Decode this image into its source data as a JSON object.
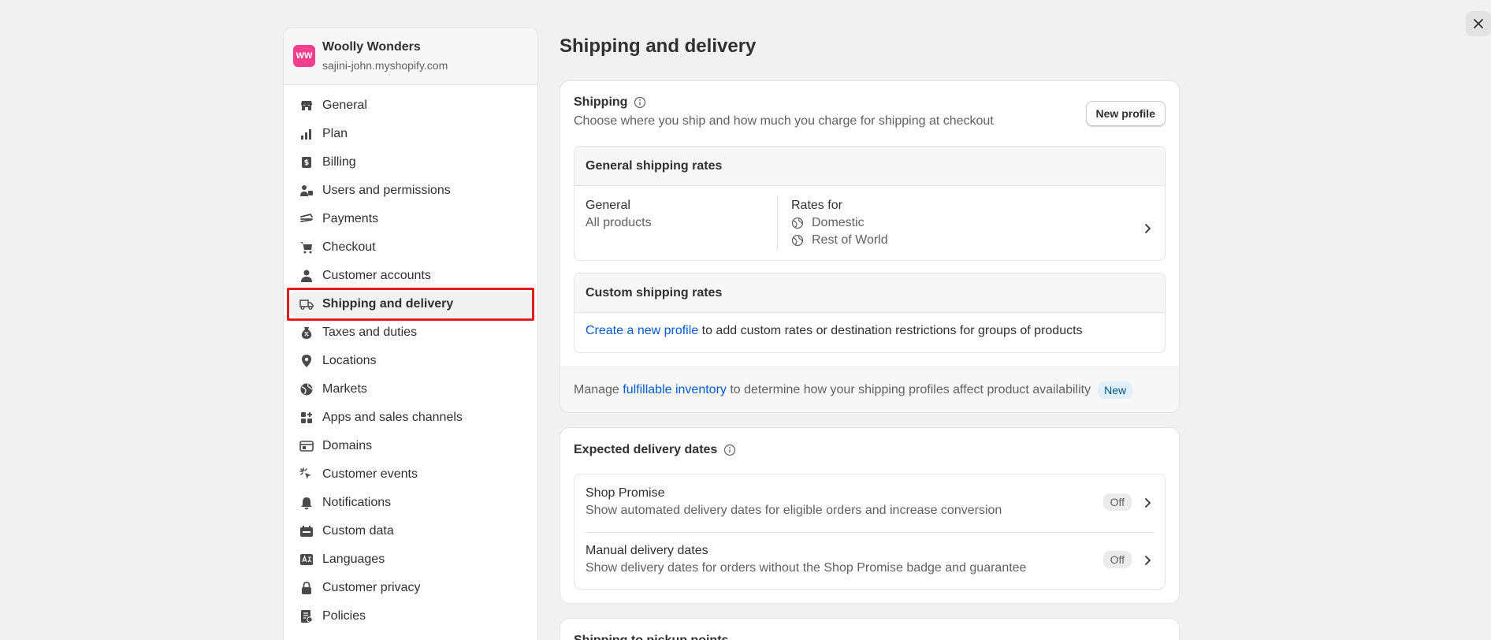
{
  "store": {
    "logo_initials": "WW",
    "name": "Woolly Wonders",
    "url": "sajini-john.myshopify.com"
  },
  "nav": {
    "items": [
      {
        "label": "General",
        "icon": "store-icon"
      },
      {
        "label": "Plan",
        "icon": "plan-icon"
      },
      {
        "label": "Billing",
        "icon": "billing-icon"
      },
      {
        "label": "Users and permissions",
        "icon": "users-icon"
      },
      {
        "label": "Payments",
        "icon": "payments-icon"
      },
      {
        "label": "Checkout",
        "icon": "cart-icon"
      },
      {
        "label": "Customer accounts",
        "icon": "person-icon"
      },
      {
        "label": "Shipping and delivery",
        "icon": "truck-icon",
        "active": true
      },
      {
        "label": "Taxes and duties",
        "icon": "tax-icon"
      },
      {
        "label": "Locations",
        "icon": "location-icon"
      },
      {
        "label": "Markets",
        "icon": "globe-icon"
      },
      {
        "label": "Apps and sales channels",
        "icon": "apps-icon"
      },
      {
        "label": "Domains",
        "icon": "domains-icon"
      },
      {
        "label": "Customer events",
        "icon": "cursor-icon"
      },
      {
        "label": "Notifications",
        "icon": "bell-icon"
      },
      {
        "label": "Custom data",
        "icon": "data-icon"
      },
      {
        "label": "Languages",
        "icon": "language-icon"
      },
      {
        "label": "Customer privacy",
        "icon": "lock-icon"
      },
      {
        "label": "Policies",
        "icon": "policies-icon"
      }
    ]
  },
  "page": {
    "title": "Shipping and delivery"
  },
  "shipping": {
    "title": "Shipping",
    "description": "Choose where you ship and how much you charge for shipping at checkout",
    "new_profile_button": "New profile",
    "general_rates": {
      "header": "General shipping rates",
      "profile_name": "General",
      "profile_scope": "All products",
      "rates_for_label": "Rates for",
      "zones": [
        "Domestic",
        "Rest of World"
      ]
    },
    "custom_rates": {
      "header": "Custom shipping rates",
      "link_text": "Create a new profile",
      "text": " to add custom rates or destination restrictions for groups of products"
    },
    "footer": {
      "prefix": "Manage ",
      "link_text": "fulfillable inventory",
      "suffix": " to determine how your shipping profiles affect product availability",
      "badge": "New"
    }
  },
  "expected_delivery": {
    "title": "Expected delivery dates",
    "rows": [
      {
        "title": "Shop Promise",
        "description": "Show automated delivery dates for eligible orders and increase conversion",
        "status": "Off"
      },
      {
        "title": "Manual delivery dates",
        "description": "Show delivery dates for orders without the Shop Promise badge and guarantee",
        "status": "Off"
      }
    ]
  },
  "pickup": {
    "title": "Shipping to pickup points"
  },
  "colors": {
    "accent_link": "#005bd3",
    "store_logo": "#f43f8e",
    "highlight": "#e11d1d"
  }
}
